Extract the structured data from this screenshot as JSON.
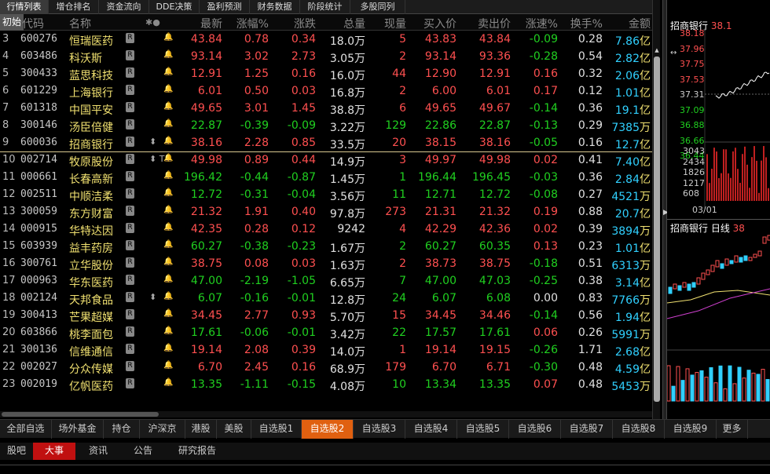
{
  "top_tabs": [
    "行情列表",
    "增仓排名",
    "资金流向",
    "DDE决策",
    "盈利预测",
    "财务数据",
    "阶段统计",
    "多股同列"
  ],
  "columns": {
    "first": "初始",
    "code": "代码",
    "name": "名称",
    "marks": "✱●",
    "last": "最新",
    "chgpct": "涨幅%",
    "chg": "涨跌",
    "vol": "总量",
    "cur": "现量",
    "bid": "买入价",
    "ask": "卖出价",
    "speed": "涨速%",
    "turn": "换手%",
    "amount": "金额"
  },
  "rows": [
    {
      "n": "3",
      "code": "600276",
      "name": "恒瑞医药",
      "last": "43.84",
      "chgpct": "0.78",
      "chg": "0.34",
      "vol": "18.0万",
      "cur": "5",
      "bid": "43.83",
      "ask": "43.84",
      "speed": "-0.09",
      "turn": "0.28",
      "amt": "7.86",
      "unit": "亿",
      "flag": ""
    },
    {
      "n": "4",
      "code": "603486",
      "name": "科沃斯",
      "last": "93.14",
      "chgpct": "3.02",
      "chg": "2.73",
      "vol": "3.05万",
      "cur": "2",
      "bid": "93.14",
      "ask": "93.36",
      "speed": "-0.28",
      "turn": "0.54",
      "amt": "2.82",
      "unit": "亿",
      "flag": ""
    },
    {
      "n": "5",
      "code": "300433",
      "name": "蓝思科技",
      "last": "12.91",
      "chgpct": "1.25",
      "chg": "0.16",
      "vol": "16.0万",
      "cur": "44",
      "bid": "12.90",
      "ask": "12.91",
      "speed": "0.16",
      "turn": "0.32",
      "amt": "2.06",
      "unit": "亿",
      "flag": ""
    },
    {
      "n": "6",
      "code": "601229",
      "name": "上海银行",
      "last": "6.01",
      "chgpct": "0.50",
      "chg": "0.03",
      "vol": "16.8万",
      "cur": "2",
      "bid": "6.00",
      "ask": "6.01",
      "speed": "0.17",
      "turn": "0.12",
      "amt": "1.01",
      "unit": "亿",
      "flag": ""
    },
    {
      "n": "7",
      "code": "601318",
      "name": "中国平安",
      "last": "49.65",
      "chgpct": "3.01",
      "chg": "1.45",
      "vol": "38.8万",
      "cur": "6",
      "bid": "49.65",
      "ask": "49.67",
      "speed": "-0.14",
      "turn": "0.36",
      "amt": "19.1",
      "unit": "亿",
      "flag": ""
    },
    {
      "n": "8",
      "code": "300146",
      "name": "汤臣倍健",
      "last": "22.87",
      "chgpct": "-0.39",
      "chg": "-0.09",
      "vol": "3.22万",
      "cur": "129",
      "bid": "22.86",
      "ask": "22.87",
      "speed": "-0.13",
      "turn": "0.29",
      "amt": "7385",
      "unit": "万",
      "flag": ""
    },
    {
      "n": "9",
      "code": "600036",
      "name": "招商银行",
      "last": "38.16",
      "chgpct": "2.28",
      "chg": "0.85",
      "vol": "33.5万",
      "cur": "20",
      "bid": "38.15",
      "ask": "38.16",
      "speed": "-0.05",
      "turn": "0.16",
      "amt": "12.7",
      "unit": "亿",
      "flag": "⬍"
    },
    {
      "n": "10",
      "code": "002714",
      "name": "牧原股份",
      "last": "49.98",
      "chgpct": "0.89",
      "chg": "0.44",
      "vol": "14.9万",
      "cur": "3",
      "bid": "49.97",
      "ask": "49.98",
      "speed": "0.02",
      "turn": "0.41",
      "amt": "7.40",
      "unit": "亿",
      "flag": "⬍ T"
    },
    {
      "n": "11",
      "code": "000661",
      "name": "长春高新",
      "last": "196.42",
      "chgpct": "-0.44",
      "chg": "-0.87",
      "vol": "1.45万",
      "cur": "1",
      "bid": "196.44",
      "ask": "196.45",
      "speed": "-0.03",
      "turn": "0.36",
      "amt": "2.84",
      "unit": "亿",
      "flag": ""
    },
    {
      "n": "12",
      "code": "002511",
      "name": "中顺洁柔",
      "last": "12.72",
      "chgpct": "-0.31",
      "chg": "-0.04",
      "vol": "3.56万",
      "cur": "11",
      "bid": "12.71",
      "ask": "12.72",
      "speed": "-0.08",
      "turn": "0.27",
      "amt": "4521",
      "unit": "万",
      "flag": ""
    },
    {
      "n": "13",
      "code": "300059",
      "name": "东方财富",
      "last": "21.32",
      "chgpct": "1.91",
      "chg": "0.40",
      "vol": "97.8万",
      "cur": "273",
      "bid": "21.31",
      "ask": "21.32",
      "speed": "0.19",
      "turn": "0.88",
      "amt": "20.7",
      "unit": "亿",
      "flag": ""
    },
    {
      "n": "14",
      "code": "000915",
      "name": "华特达因",
      "last": "42.35",
      "chgpct": "0.28",
      "chg": "0.12",
      "vol": "9242",
      "cur": "4",
      "bid": "42.29",
      "ask": "42.36",
      "speed": "0.02",
      "turn": "0.39",
      "amt": "3894",
      "unit": "万",
      "flag": ""
    },
    {
      "n": "15",
      "code": "603939",
      "name": "益丰药房",
      "last": "60.27",
      "chgpct": "-0.38",
      "chg": "-0.23",
      "vol": "1.67万",
      "cur": "2",
      "bid": "60.27",
      "ask": "60.35",
      "speed": "0.13",
      "turn": "0.23",
      "amt": "1.01",
      "unit": "亿",
      "flag": ""
    },
    {
      "n": "16",
      "code": "300761",
      "name": "立华股份",
      "last": "38.75",
      "chgpct": "0.08",
      "chg": "0.03",
      "vol": "1.63万",
      "cur": "2",
      "bid": "38.73",
      "ask": "38.75",
      "speed": "-0.18",
      "turn": "0.51",
      "amt": "6313",
      "unit": "万",
      "flag": ""
    },
    {
      "n": "17",
      "code": "000963",
      "name": "华东医药",
      "last": "47.00",
      "chgpct": "-2.19",
      "chg": "-1.05",
      "vol": "6.65万",
      "cur": "7",
      "bid": "47.00",
      "ask": "47.03",
      "speed": "-0.25",
      "turn": "0.38",
      "amt": "3.14",
      "unit": "亿",
      "flag": ""
    },
    {
      "n": "18",
      "code": "002124",
      "name": "天邦食品",
      "last": "6.07",
      "chgpct": "-0.16",
      "chg": "-0.01",
      "vol": "12.8万",
      "cur": "24",
      "bid": "6.07",
      "ask": "6.08",
      "speed": "0.00",
      "turn": "0.83",
      "amt": "7766",
      "unit": "万",
      "flag": "⬍"
    },
    {
      "n": "19",
      "code": "300413",
      "name": "芒果超媒",
      "last": "34.45",
      "chgpct": "2.77",
      "chg": "0.93",
      "vol": "5.70万",
      "cur": "15",
      "bid": "34.45",
      "ask": "34.46",
      "speed": "-0.14",
      "turn": "0.56",
      "amt": "1.94",
      "unit": "亿",
      "flag": ""
    },
    {
      "n": "20",
      "code": "603866",
      "name": "桃李面包",
      "last": "17.61",
      "chgpct": "-0.06",
      "chg": "-0.01",
      "vol": "3.42万",
      "cur": "22",
      "bid": "17.57",
      "ask": "17.61",
      "speed": "0.06",
      "turn": "0.26",
      "amt": "5991",
      "unit": "万",
      "flag": ""
    },
    {
      "n": "21",
      "code": "300136",
      "name": "信维通信",
      "last": "19.14",
      "chgpct": "2.08",
      "chg": "0.39",
      "vol": "14.0万",
      "cur": "1",
      "bid": "19.14",
      "ask": "19.15",
      "speed": "-0.26",
      "turn": "1.71",
      "amt": "2.68",
      "unit": "亿",
      "flag": ""
    },
    {
      "n": "22",
      "code": "002027",
      "name": "分众传媒",
      "last": "6.70",
      "chgpct": "2.45",
      "chg": "0.16",
      "vol": "68.9万",
      "cur": "179",
      "bid": "6.70",
      "ask": "6.71",
      "speed": "-0.30",
      "turn": "0.48",
      "amt": "4.59",
      "unit": "亿",
      "flag": ""
    },
    {
      "n": "23",
      "code": "002019",
      "name": "亿帆医药",
      "last": "13.35",
      "chgpct": "-1.11",
      "chg": "-0.15",
      "vol": "4.08万",
      "cur": "10",
      "bid": "13.34",
      "ask": "13.35",
      "speed": "0.07",
      "turn": "0.48",
      "amt": "5453",
      "unit": "万",
      "flag": ""
    }
  ],
  "bottom_tabs": [
    "全部自选",
    "场外基金",
    "持仓",
    "沪深京",
    "港股",
    "美股",
    "自选股1",
    "自选股2",
    "自选股3",
    "自选股4",
    "自选股5",
    "自选股6",
    "自选股7",
    "自选股8",
    "自选股9",
    "更多"
  ],
  "active_bottom_tab": 7,
  "news_tabs": [
    "股吧",
    "大事",
    "资讯",
    "公告",
    "研究报告"
  ],
  "active_news_tab": 1,
  "right_panel": {
    "title": "招商银行",
    "title_price": "38.1",
    "prices": [
      "38.18",
      "37.96",
      "37.75",
      "37.53",
      "37.31",
      "37.09",
      "36.88",
      "36.66",
      "36.44"
    ],
    "vol_labels": [
      "3043",
      "2434",
      "1826",
      "1217",
      "608"
    ],
    "date": "03/01",
    "kline_title": "招商银行 日线",
    "kline_price": "38"
  },
  "colors": {
    "up": "#ff5050",
    "down": "#20d020",
    "accent": "#e06010",
    "name": "#f0e070"
  }
}
